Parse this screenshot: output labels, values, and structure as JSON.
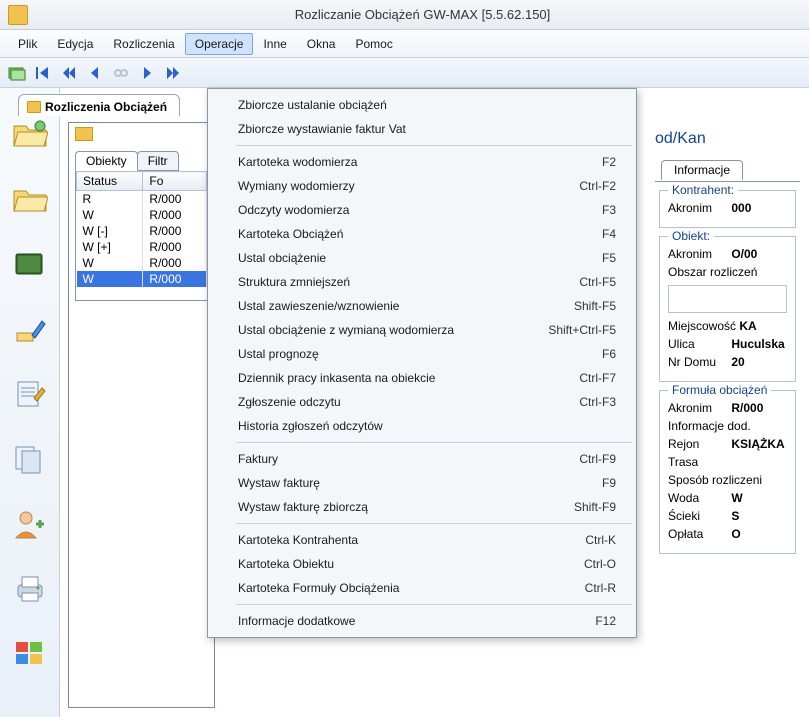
{
  "title": "Rozliczanie Obciążeń GW-MAX [5.5.62.150]",
  "menubar": [
    "Plik",
    "Edycja",
    "Rozliczenia",
    "Operacje",
    "Inne",
    "Okna",
    "Pomoc"
  ],
  "active_menu_index": 3,
  "doc_tab": "Rozliczenia Obciążeń",
  "inner_tabs": {
    "a": "Obiekty",
    "b": "Filtr"
  },
  "grid_headers": [
    "Status",
    "Fo"
  ],
  "grid_rows": [
    {
      "status": "R",
      "fo": "R/000"
    },
    {
      "status": "W",
      "fo": "R/000"
    },
    {
      "status": "W [-]",
      "fo": "R/000"
    },
    {
      "status": "W [+]",
      "fo": "R/000"
    },
    {
      "status": "W",
      "fo": "R/000"
    },
    {
      "status": "W",
      "fo": "R/000",
      "selected": true
    }
  ],
  "right": {
    "header_suffix": "od/Kan",
    "tab": "Informacje",
    "kontrahent": {
      "legend": "Kontrahent:",
      "akronim_label": "Akronim",
      "akronim_value": "000"
    },
    "obiekt": {
      "legend": "Obiekt:",
      "akronim_label": "Akronim",
      "akronim_value": "O/00",
      "obszar_label": "Obszar rozliczeń",
      "miejscowosc_label": "Miejscowość",
      "miejscowosc_value": "KA",
      "ulica_label": "Ulica",
      "ulica_value": "Huculska",
      "nrdomu_label": "Nr Domu",
      "nrdomu_value": "20"
    },
    "formula": {
      "legend": "Formuła obciążeń",
      "akronim_label": "Akronim",
      "akronim_value": "R/000",
      "info_label": "Informacje dod.",
      "rejon_label": "Rejon",
      "rejon_value": "KSIĄŻKA",
      "trasa_label": "Trasa",
      "sposob_label": "Sposób rozliczeni",
      "woda_label": "Woda",
      "woda_value": "W",
      "scieki_label": "Ścieki",
      "scieki_value": "S",
      "oplata_label": "Opłata",
      "oplata_value": "O"
    }
  },
  "dropdown": [
    {
      "type": "item",
      "label": "Zbiorcze ustalanie obciążeń"
    },
    {
      "type": "item",
      "label": "Zbiorcze wystawianie faktur Vat"
    },
    {
      "type": "sep"
    },
    {
      "type": "item",
      "label": "Kartoteka wodomierza",
      "shortcut": "F2"
    },
    {
      "type": "item",
      "label": "Wymiany wodomierzy",
      "shortcut": "Ctrl-F2"
    },
    {
      "type": "item",
      "label": "Odczyty wodomierza",
      "shortcut": "F3"
    },
    {
      "type": "item",
      "label": "Kartoteka Obciążeń",
      "shortcut": "F4"
    },
    {
      "type": "item",
      "label": "Ustal obciążenie",
      "shortcut": "F5"
    },
    {
      "type": "item",
      "label": "Struktura zmniejszeń",
      "shortcut": "Ctrl-F5"
    },
    {
      "type": "item",
      "label": "Ustal zawieszenie/wznowienie",
      "shortcut": "Shift-F5"
    },
    {
      "type": "item",
      "label": "Ustal obciążenie z wymianą wodomierza",
      "shortcut": "Shift+Ctrl-F5"
    },
    {
      "type": "item",
      "label": "Ustal prognozę",
      "shortcut": "F6"
    },
    {
      "type": "item",
      "label": "Dziennik pracy inkasenta na obiekcie",
      "shortcut": "Ctrl-F7"
    },
    {
      "type": "item",
      "label": "Zgłoszenie odczytu",
      "shortcut": "Ctrl-F3"
    },
    {
      "type": "item",
      "label": "Historia zgłoszeń odczytów"
    },
    {
      "type": "sep"
    },
    {
      "type": "item",
      "label": "Faktury",
      "shortcut": "Ctrl-F9"
    },
    {
      "type": "item",
      "label": "Wystaw fakturę",
      "shortcut": "F9"
    },
    {
      "type": "item",
      "label": "Wystaw fakturę zbiorczą",
      "shortcut": "Shift-F9"
    },
    {
      "type": "sep"
    },
    {
      "type": "item",
      "label": "Kartoteka Kontrahenta",
      "shortcut": "Ctrl-K"
    },
    {
      "type": "item",
      "label": "Kartoteka Obiektu",
      "shortcut": "Ctrl-O"
    },
    {
      "type": "item",
      "label": "Kartoteka Formuły Obciążenia",
      "shortcut": "Ctrl-R"
    },
    {
      "type": "sep"
    },
    {
      "type": "item",
      "label": "Informacje dodatkowe",
      "shortcut": "F12"
    }
  ]
}
